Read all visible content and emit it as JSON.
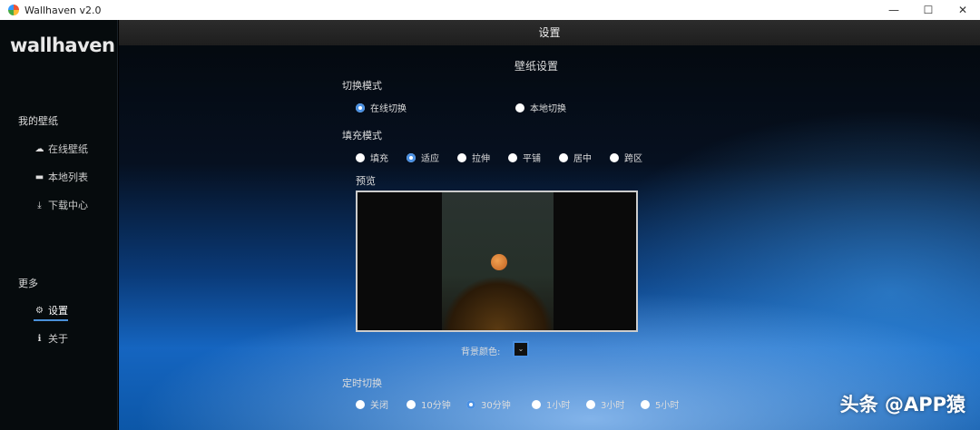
{
  "window": {
    "title": "Wallhaven v2.0",
    "minimize": "—",
    "maximize": "☐",
    "close": "✕"
  },
  "sidebar": {
    "logo": "wallhaven",
    "section_mine": "我的壁纸",
    "items": [
      {
        "icon": "cloud-icon",
        "glyph": "☁",
        "label": "在线壁纸"
      },
      {
        "icon": "folder-icon",
        "glyph": "▬",
        "label": "本地列表"
      },
      {
        "icon": "download-icon",
        "glyph": "⤓",
        "label": "下载中心"
      }
    ],
    "section_more": "更多",
    "more_items": [
      {
        "icon": "gear-icon",
        "glyph": "⚙",
        "label": "设置"
      },
      {
        "icon": "info-icon",
        "glyph": "ℹ",
        "label": "关于"
      }
    ]
  },
  "header": {
    "title": "设置"
  },
  "settings": {
    "title": "壁纸设置",
    "switch_mode": {
      "label": "切换模式",
      "options": [
        "在线切换",
        "本地切换"
      ],
      "selected": 0
    },
    "fill_mode": {
      "label": "填充模式",
      "options": [
        "填充",
        "适应",
        "拉伸",
        "平铺",
        "居中",
        "跨区"
      ],
      "selected": 1
    },
    "preview_label": "预览",
    "bg_color_label": "背景颜色:",
    "bg_color_btn": "⌄",
    "bg_color": "#111111",
    "timer": {
      "label": "定时切换",
      "options": [
        "关闭",
        "10分钟",
        "30分钟",
        "1小时",
        "3小时",
        "5小时"
      ],
      "selected": 2
    }
  },
  "watermark": "头条 @APP猿"
}
